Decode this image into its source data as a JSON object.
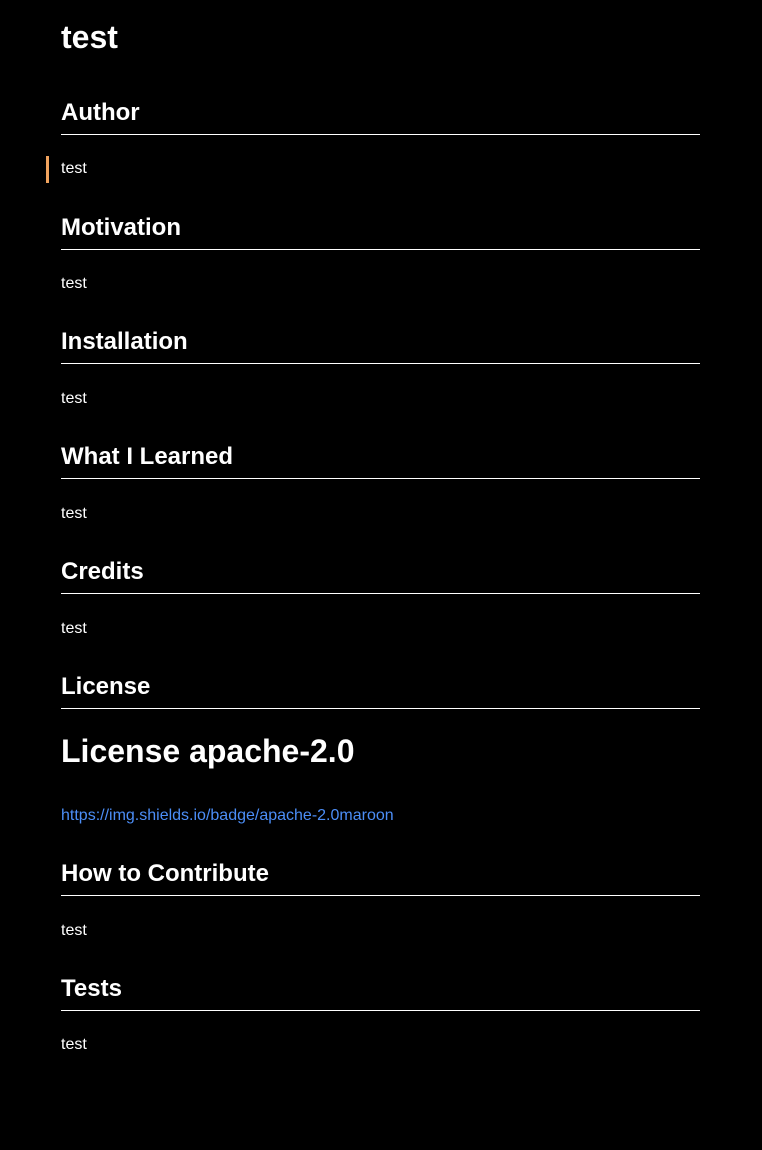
{
  "document": {
    "title": "test",
    "sections": {
      "author": {
        "heading": "Author",
        "text": "test"
      },
      "motivation": {
        "heading": "Motivation",
        "text": "test"
      },
      "installation": {
        "heading": "Installation",
        "text": "test"
      },
      "learned": {
        "heading": "What I Learned",
        "text": "test"
      },
      "credits": {
        "heading": "Credits",
        "text": "test"
      },
      "license": {
        "heading": "License",
        "subheading": "License apache-2.0",
        "badge_link": "https://img.shields.io/badge/apache-2.0maroon"
      },
      "contribute": {
        "heading": "How to Contribute",
        "text": "test"
      },
      "tests": {
        "heading": "Tests",
        "text": "test"
      }
    }
  },
  "colors": {
    "background": "#000000",
    "text": "#ffffff",
    "link": "#4c8ef7",
    "cursor_marker": "#f0a35e"
  }
}
